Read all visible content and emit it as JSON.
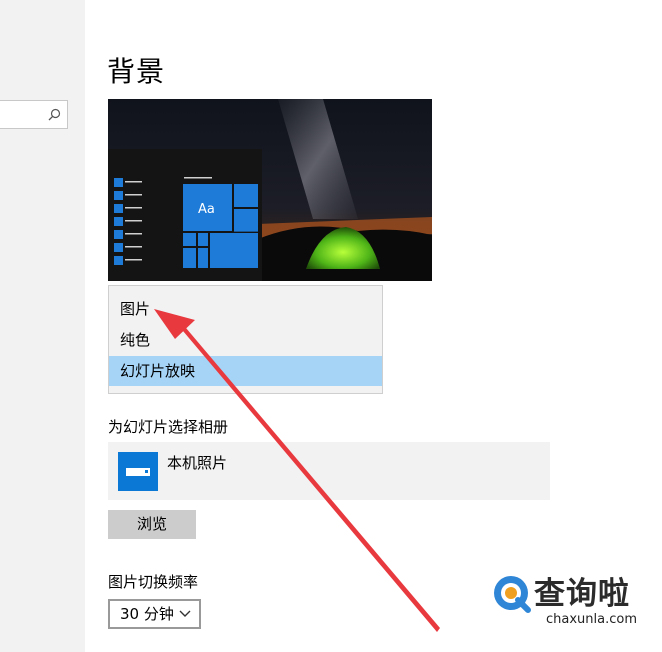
{
  "page": {
    "title": "背景"
  },
  "preview": {
    "tile_text": "Aa"
  },
  "background_dropdown": {
    "options": [
      "图片",
      "纯色",
      "幻灯片放映"
    ],
    "selected_index": 2
  },
  "slideshow": {
    "album_label": "为幻灯片选择相册",
    "album_name": "本机照片",
    "browse_label": "浏览",
    "frequency_label": "图片切换频率",
    "frequency_value": "30 分钟"
  },
  "watermark": {
    "text_cn": "查询啦",
    "text_en": "chaxunla.com"
  },
  "colors": {
    "accent": "#0a78d4",
    "selected": "#a6d4f7",
    "arrow": "#e8393f"
  },
  "icons": [
    "search-icon",
    "chevron-down-icon",
    "album-icon",
    "q-logo-icon"
  ]
}
